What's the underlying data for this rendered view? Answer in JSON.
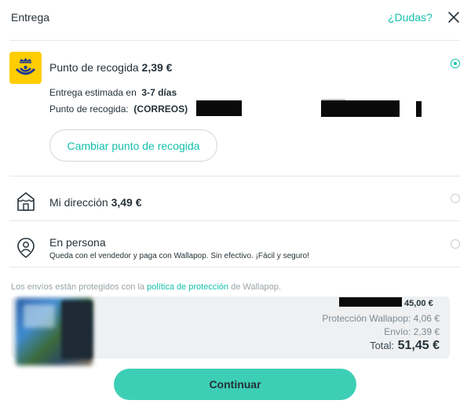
{
  "header": {
    "title": "Entrega",
    "help_label": "¿Dudas?"
  },
  "options": {
    "pickup": {
      "label": "Punto de recogida",
      "price": "2,39 €",
      "estimate_label": "Entrega estimada en",
      "estimate_value": "3-7 días",
      "point_label": "Punto de recogida:",
      "point_value": "(CORREOS)",
      "change_button": "Cambiar punto de recogida",
      "selected": true
    },
    "home": {
      "label": "Mi dirección",
      "price": "3,49 €",
      "selected": false
    },
    "in_person": {
      "label": "En persona",
      "subtitle": "Queda con el vendedor y paga con Wallapop. Sin efectivo. ¡Fácil y seguro!",
      "selected": false
    }
  },
  "protection_note": {
    "before": "Los envíos están protegidos con la",
    "link": "política de protección",
    "after": "de Wallapop."
  },
  "summary": {
    "item_price": "45,00 €",
    "protection": "Protección Wallapop: 4,06 €",
    "shipping": "Envío: 2,39 €",
    "total_label": "Total:",
    "total_value": "51,45 €"
  },
  "continue_button": "Continuar",
  "colors": {
    "accent": "#13c1ac",
    "button": "#3dcfb6",
    "correos_yellow": "#ffcd00",
    "correos_blue": "#1f3a93"
  }
}
